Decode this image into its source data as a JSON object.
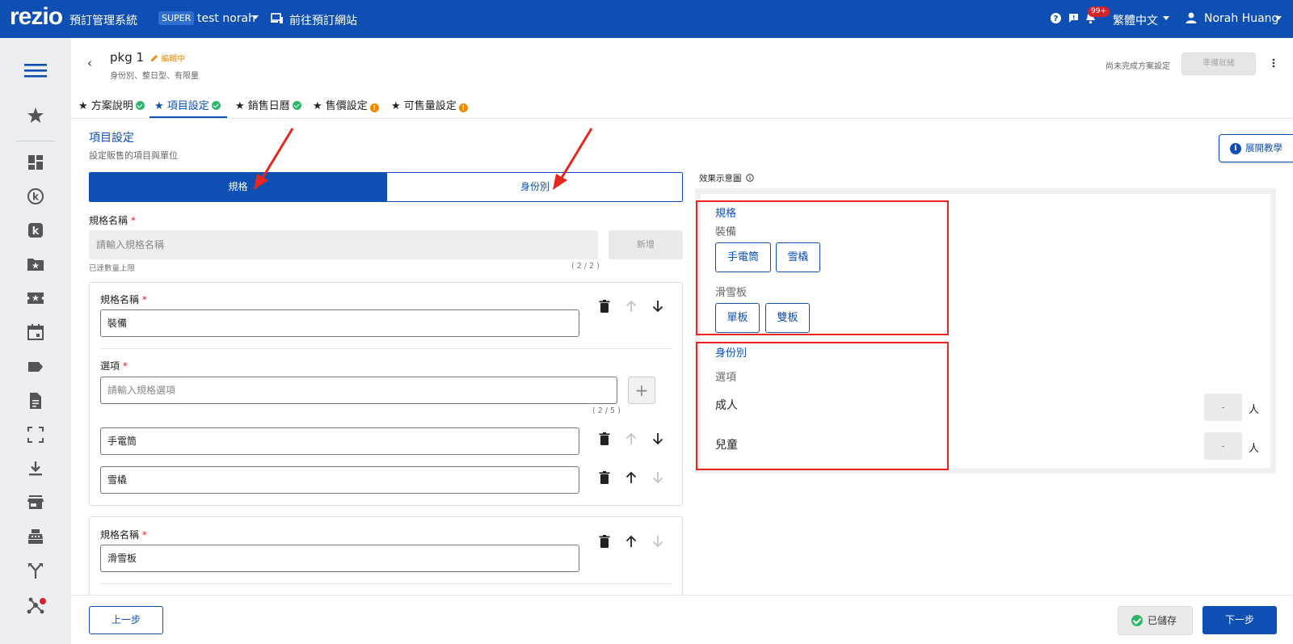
{
  "topbar": {
    "logo": "rezio",
    "system_name": "預訂管理系統",
    "role_badge": "SUPER",
    "account": "test norah",
    "goto_site": "前往預訂網站",
    "notification_count": "99+",
    "language": "繁體中文",
    "user": "Norah Huang"
  },
  "sidebar": {
    "icons": [
      "menu-icon",
      "star-icon",
      "dashboard-icon",
      "k-outline-icon",
      "k-filled-icon",
      "folder-star-icon",
      "ticket-star-icon",
      "calendar-icon",
      "tag-icon",
      "document-icon",
      "scan-icon",
      "download-icon",
      "store-icon",
      "cashier-icon",
      "fork-icon",
      "network-icon"
    ]
  },
  "header": {
    "back": "‹",
    "title": "pkg 1",
    "status": "編輯中",
    "subtitle": "身份別、整日型、有限量",
    "incomplete_note": "尚未完成方案設定",
    "ready_button": "準備就緒",
    "more": "⋮"
  },
  "tabs": [
    {
      "label": "★ 方案說明",
      "status": "ok"
    },
    {
      "label": "★ 項目設定",
      "status": "ok"
    },
    {
      "label": "★ 銷售日曆",
      "status": "ok"
    },
    {
      "label": "★ 售價設定",
      "status": "warn"
    },
    {
      "label": "★ 可售量設定",
      "status": "warn"
    }
  ],
  "section": {
    "title": "項目設定",
    "subtitle": "設定販售的項目與單位",
    "toggle_spec": "規格",
    "toggle_identity": "身份別"
  },
  "spec_form": {
    "name_label": "規格名稱",
    "required_mark": "*",
    "name_placeholder": "請輸入規格名稱",
    "add_button": "新增",
    "limit_note": "已達數量上限",
    "count": "( 2 / 2 )"
  },
  "spec_cards": [
    {
      "name_label": "規格名稱",
      "name_value": "裝備",
      "options_label": "選項",
      "option_placeholder": "請輸入規格選項",
      "option_count": "( 2 / 5 )",
      "options": [
        "手電筒",
        "雪橇"
      ]
    },
    {
      "name_label": "規格名稱",
      "name_value": "滑雪板"
    }
  ],
  "preview": {
    "label": "效果示意圖",
    "spec_heading": "規格",
    "groups": [
      {
        "name": "裝備",
        "options": [
          "手電筒",
          "雪橇"
        ]
      },
      {
        "name": "滑雪板",
        "options": [
          "單板",
          "雙板"
        ]
      }
    ],
    "identity_heading": "身份別",
    "options_label": "選項",
    "identities": [
      {
        "name": "成人",
        "value": "-",
        "unit": "人"
      },
      {
        "name": "兒童",
        "value": "-",
        "unit": "人"
      }
    ]
  },
  "tutorial_button": "展開教學",
  "footer": {
    "prev": "上一步",
    "saved": "已儲存",
    "next": "下一步"
  },
  "colors": {
    "brand_blue": "#0e4fb4",
    "ok_green": "#2eb56a",
    "warn_orange": "#f08a00",
    "annotation_red": "#e8261d"
  }
}
